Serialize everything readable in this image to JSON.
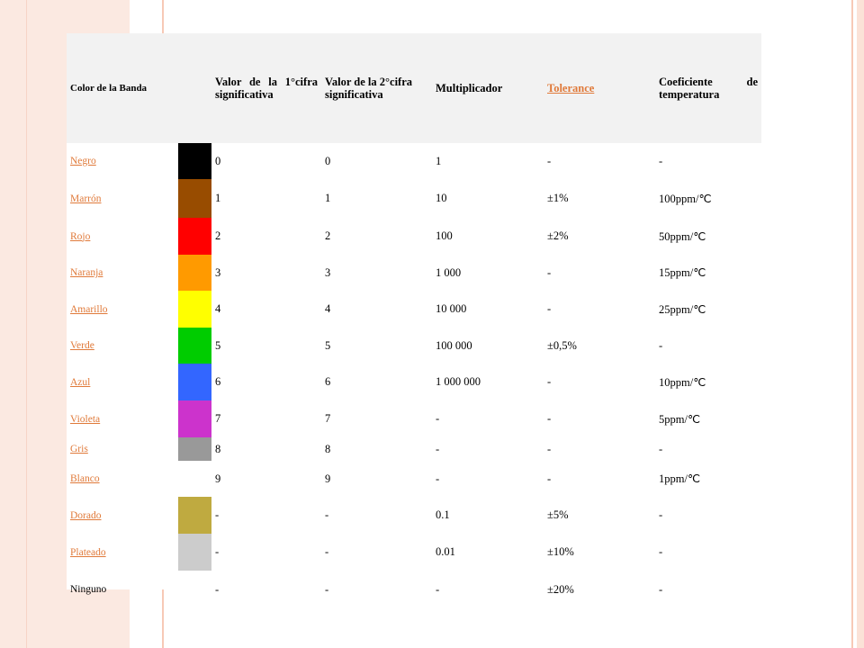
{
  "headers": {
    "color": "Color de la Banda",
    "first_digit": "Valor de la 1°cifra significativa",
    "second_digit": "Valor de la 2°cifra significativa",
    "multiplier": "Multiplicador",
    "tolerance": "Tolerance",
    "temp_coef": "Coeficiente de temperatura"
  },
  "rows": [
    {
      "name": "Negro",
      "color": "#000000",
      "d1": "0",
      "d2": "0",
      "mult": "1",
      "tol": "-",
      "temp": "-",
      "link": true,
      "h": 40
    },
    {
      "name": "Marrón",
      "color": "#984c00",
      "d1": "1",
      "d2": "1",
      "mult": "10",
      "tol": "±1%",
      "temp": "100ppm/℃",
      "link": true,
      "h": 43
    },
    {
      "name": "Rojo",
      "color": "#ff0000",
      "d1": "2",
      "d2": "2",
      "mult": "100",
      "tol": "±2%",
      "temp": "50ppm/℃",
      "link": true,
      "h": 41
    },
    {
      "name": "Naranja",
      "color": "#ff9a00",
      "d1": "3",
      "d2": "3",
      "mult": "1 000",
      "tol": "-",
      "temp": "15ppm/℃",
      "link": true,
      "h": 40
    },
    {
      "name": "Amarillo",
      "color": "#ffff00",
      "d1": "4",
      "d2": "4",
      "mult": "10 000",
      "tol": "-",
      "temp": "25ppm/℃",
      "link": true,
      "h": 41
    },
    {
      "name": "Verde",
      "color": "#00cc00",
      "d1": "5",
      "d2": "5",
      "mult": "100 000",
      "tol": "±0,5%",
      "temp": "-",
      "link": true,
      "h": 40
    },
    {
      "name": "Azul",
      "color": "#3366ff",
      "d1": "6",
      "d2": "6",
      "mult": "1 000 000",
      "tol": "-",
      "temp": "10ppm/℃",
      "link": true,
      "h": 41
    },
    {
      "name": "Violeta",
      "color": "#cc33cc",
      "d1": "7",
      "d2": "7",
      "mult": "-",
      "tol": "-",
      "temp": "5ppm/℃",
      "link": true,
      "h": 41
    },
    {
      "name": "Gris",
      "color": "#999999",
      "d1": "8",
      "d2": "8",
      "mult": "-",
      "tol": "-",
      "temp": "-",
      "link": true,
      "h": 26
    },
    {
      "name": "Blanco",
      "color": "#ffffff",
      "d1": "9",
      "d2": "9",
      "mult": "-",
      "tol": "-",
      "temp": "1ppm/℃",
      "link": true,
      "h": 40
    },
    {
      "name": "Dorado",
      "color": "#bfaa40",
      "d1": "-",
      "d2": "-",
      "mult": "0.1",
      "tol": "±5%",
      "temp": "-",
      "link": true,
      "h": 41
    },
    {
      "name": "Plateado",
      "color": "#cccccc",
      "d1": "-",
      "d2": "-",
      "mult": "0.01",
      "tol": "±10%",
      "temp": "-",
      "link": true,
      "h": 41
    },
    {
      "name": "Ninguno",
      "color": "#ffffff",
      "d1": "-",
      "d2": "-",
      "mult": "-",
      "tol": "±20%",
      "temp": "-",
      "link": false,
      "h": 42
    }
  ]
}
